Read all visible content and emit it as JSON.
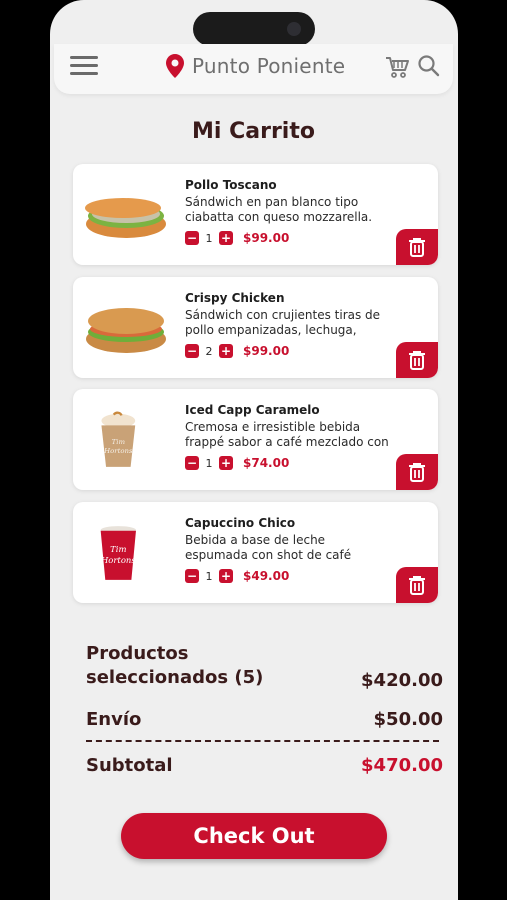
{
  "header": {
    "location": "Punto Poniente",
    "icons": [
      "menu-icon",
      "location-pin-icon",
      "cart-icon",
      "search-icon"
    ]
  },
  "page_title": "Mi Carrito",
  "cart_items": [
    {
      "name": "Pollo Toscano",
      "description": "Sándwich en pan blanco tipo ciabatta con queso mozzarella.",
      "quantity": "1",
      "price": "$99.00",
      "image": "sandwich-image"
    },
    {
      "name": "Crispy Chicken",
      "description": "Sándwich con crujientes tiras de pollo empanizadas, lechuga, tomate",
      "quantity": "2",
      "price": "$99.00",
      "image": "sandwich-image"
    },
    {
      "name": "Iced Capp Caramelo",
      "description": "Cremosa e irresistible bebida frappé sabor a café mezclado con crema y",
      "quantity": "1",
      "price": "$74.00",
      "image": "iced-drink-image"
    },
    {
      "name": "Capuccino Chico",
      "description": "Bebida a base de leche espumada con shot de café espresso.",
      "quantity": "1",
      "price": "$49.00",
      "image": "coffee-cup-image"
    }
  ],
  "quantity_controls": {
    "minus": "−",
    "plus": "+"
  },
  "summary": {
    "products_label_line1": "Productos",
    "products_label_line2": "seleccionados (5)",
    "products_value": "$420.00",
    "shipping_label": "Envío",
    "shipping_value": "$50.00",
    "subtotal_label": "Subtotal",
    "subtotal_value": "$470.00"
  },
  "checkout_label": "Check Out",
  "colors": {
    "accent": "#c8102e",
    "background": "#efefef",
    "card": "#ffffff",
    "text_dark": "#3a1b1b"
  }
}
